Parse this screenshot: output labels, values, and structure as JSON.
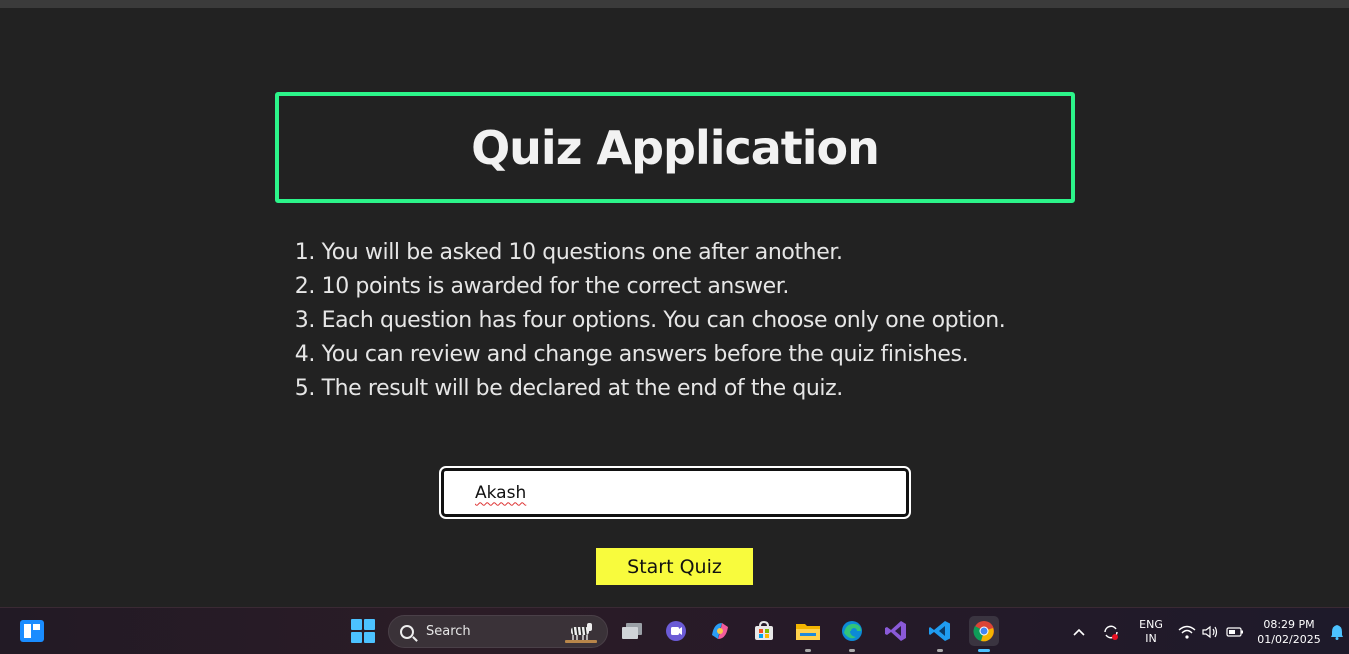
{
  "page": {
    "title": "Quiz Application",
    "rules": [
      {
        "num": "1.",
        "text": "You will be asked 10 questions one after another."
      },
      {
        "num": "2.",
        "text": "10 points is awarded for the correct answer."
      },
      {
        "num": "3.",
        "text": "Each question has four options. You can choose only one option."
      },
      {
        "num": "4.",
        "text": "You can review and change answers before the quiz finishes."
      },
      {
        "num": "5.",
        "text": "The result will be declared at the end of the quiz."
      }
    ],
    "name_input": {
      "value": "Akash"
    },
    "start_button": "Start Quiz"
  },
  "colors": {
    "background": "#222222",
    "title_border": "#2cf58a",
    "button": "#f8fb3d"
  },
  "taskbar": {
    "search_label": "Search",
    "apps": [
      "task-view",
      "meet",
      "copilot",
      "microsoft-store",
      "file-explorer",
      "edge",
      "visual-studio",
      "vscode",
      "chrome"
    ],
    "language": {
      "line1": "ENG",
      "line2": "IN"
    },
    "time": "08:29 PM",
    "date": "01/02/2025"
  }
}
